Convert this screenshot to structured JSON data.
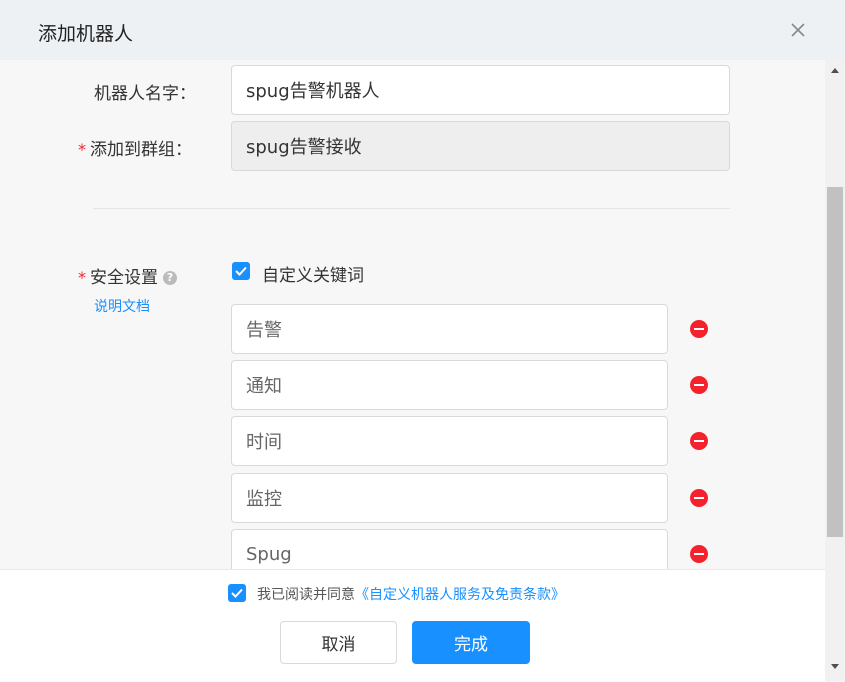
{
  "dialog": {
    "title": "添加机器人"
  },
  "form": {
    "robot_name": {
      "label": "机器人名字：",
      "value": "spug告警机器人"
    },
    "group": {
      "label": "添加到群组：",
      "value": "spug告警接收"
    },
    "security": {
      "label": "安全设置",
      "help_icon": "?",
      "doc_link": "说明文档",
      "custom_keywords_label": "自定义关键词",
      "custom_keywords_checked": true,
      "keywords": [
        "告警",
        "通知",
        "时间",
        "监控",
        "Spug"
      ]
    }
  },
  "footer": {
    "agree_prefix": "我已阅读并同意",
    "agree_link": "《自定义机器人服务及免责条款》",
    "agree_checked": true,
    "cancel_label": "取消",
    "ok_label": "完成"
  },
  "colors": {
    "primary": "#1890ff",
    "danger": "#f5222d",
    "header_bg": "#eef1f4"
  },
  "icons": {
    "close": "close-icon",
    "help": "help-circle-icon",
    "checkbox": "check-icon",
    "remove": "minus-circle-icon"
  }
}
